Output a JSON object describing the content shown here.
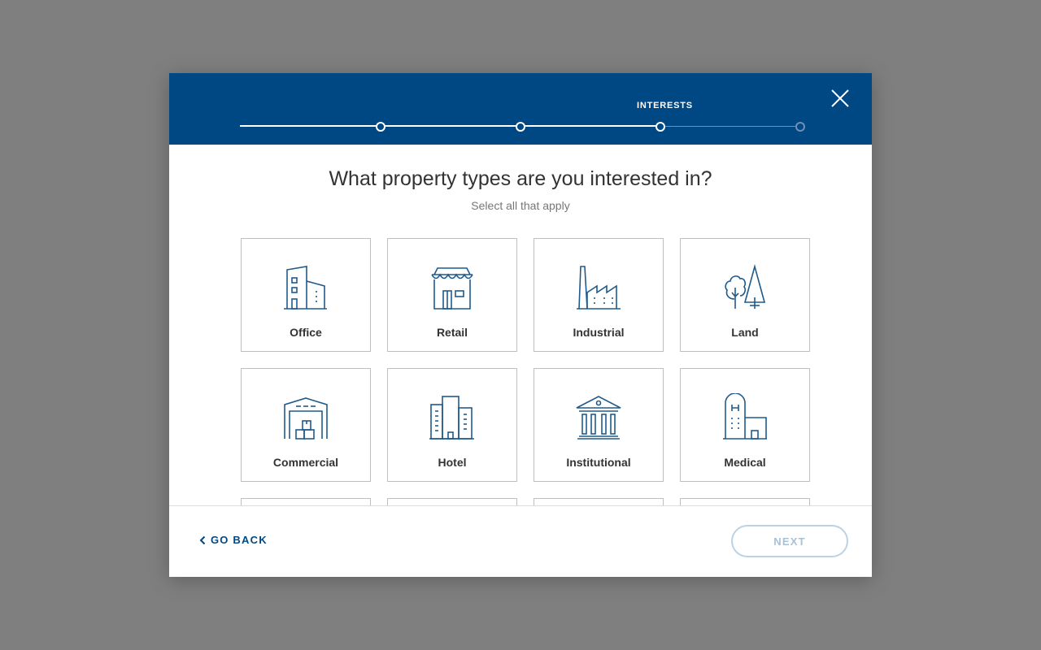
{
  "progress": {
    "current_step_label": "INTERESTS",
    "steps_total": 4,
    "steps_completed": 3
  },
  "question": {
    "title": "What property types are you interested in?",
    "subtitle": "Select all that apply"
  },
  "property_types": [
    {
      "label": "Office",
      "icon": "office-building-icon"
    },
    {
      "label": "Retail",
      "icon": "storefront-icon"
    },
    {
      "label": "Industrial",
      "icon": "factory-icon"
    },
    {
      "label": "Land",
      "icon": "trees-icon"
    },
    {
      "label": "Commercial",
      "icon": "warehouse-icon"
    },
    {
      "label": "Hotel",
      "icon": "hotel-icon"
    },
    {
      "label": "Institutional",
      "icon": "institution-icon"
    },
    {
      "label": "Medical",
      "icon": "hospital-icon"
    }
  ],
  "footer": {
    "back_label": "GO BACK",
    "next_label": "NEXT"
  },
  "colors": {
    "header_bg": "#004883",
    "icon_stroke": "#1f5a8c",
    "next_disabled": "#a9c1d6",
    "overlay": "#7f7f7f"
  }
}
